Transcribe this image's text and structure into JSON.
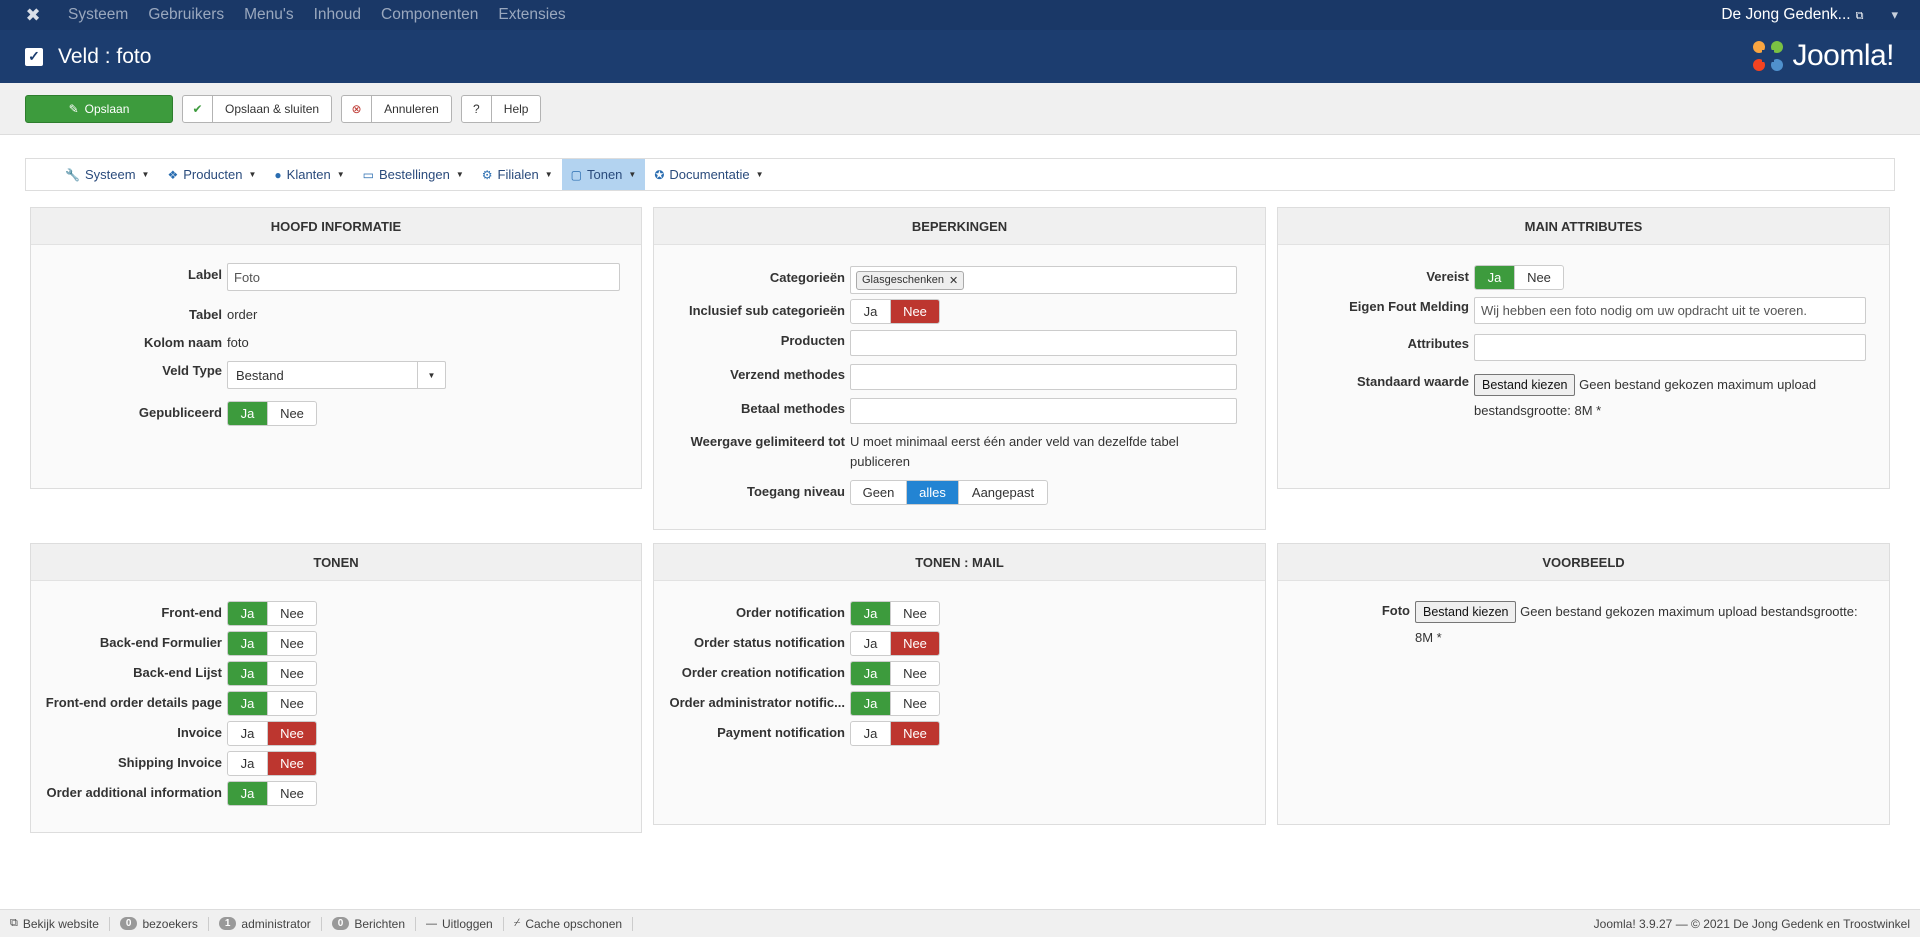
{
  "topnav": {
    "menu": [
      "Systeem",
      "Gebruikers",
      "Menu's",
      "Inhoud",
      "Componenten",
      "Extensies"
    ],
    "site_name": "De Jong Gedenk...",
    "user_icon": "user-icon"
  },
  "titlebar": {
    "title": "Veld : foto",
    "brand": "Joomla!"
  },
  "toolbar": {
    "save": "Opslaan",
    "save_close": "Opslaan & sluiten",
    "cancel": "Annuleren",
    "help": "Help"
  },
  "component_menu": [
    {
      "label": "Systeem",
      "icon": "wrench-icon"
    },
    {
      "label": "Producten",
      "icon": "cubes-icon"
    },
    {
      "label": "Klanten",
      "icon": "user-icon"
    },
    {
      "label": "Bestellingen",
      "icon": "credit-card-icon"
    },
    {
      "label": "Filialen",
      "icon": "cogs-icon"
    },
    {
      "label": "Tonen",
      "icon": "monitor-icon"
    },
    {
      "label": "Documentatie",
      "icon": "life-ring-icon"
    }
  ],
  "hoofd": {
    "title": "HOOFD INFORMATIE",
    "label_lbl": "Label",
    "label_val": "Foto",
    "tabel_lbl": "Tabel",
    "tabel_val": "order",
    "kolom_lbl": "Kolom naam",
    "kolom_val": "foto",
    "type_lbl": "Veld Type",
    "type_val": "Bestand",
    "pub_lbl": "Gepubliceerd"
  },
  "toggle": {
    "ja": "Ja",
    "nee": "Nee"
  },
  "beperkingen": {
    "title": "BEPERKINGEN",
    "cat_lbl": "Categorieën",
    "cat_tag": "Glasgeschenken",
    "sub_lbl": "Inclusief sub categorieën",
    "prod_lbl": "Producten",
    "verzend_lbl": "Verzend methodes",
    "betaal_lbl": "Betaal methodes",
    "weergave_lbl": "Weergave gelimiteerd tot",
    "weergave_val": "U moet minimaal eerst één ander veld van dezelfde tabel publiceren",
    "toegang_lbl": "Toegang niveau",
    "toegang_opts": [
      "Geen",
      "alles",
      "Aangepast"
    ]
  },
  "main_attr": {
    "title": "MAIN ATTRIBUTES",
    "vereist_lbl": "Vereist",
    "fout_lbl": "Eigen Fout Melding",
    "fout_val": "Wij hebben een foto nodig om uw opdracht uit te voeren.",
    "attr_lbl": "Attributes",
    "std_lbl": "Standaard waarde",
    "file_btn": "Bestand kiezen",
    "file_text_1": "Geen bestand gekozen maximum upload",
    "file_text_2": "bestandsgrootte: 8M *"
  },
  "tonen": {
    "title": "TONEN",
    "rows": [
      {
        "label": "Front-end",
        "state": "ja"
      },
      {
        "label": "Back-end Formulier",
        "state": "ja"
      },
      {
        "label": "Back-end Lijst",
        "state": "ja"
      },
      {
        "label": "Front-end order details page",
        "state": "ja"
      },
      {
        "label": "Invoice",
        "state": "nee"
      },
      {
        "label": "Shipping Invoice",
        "state": "nee"
      },
      {
        "label": "Order additional information",
        "state": "ja"
      }
    ]
  },
  "tonen_mail": {
    "title": "TONEN : MAIL",
    "rows": [
      {
        "label": "Order notification",
        "state": "ja"
      },
      {
        "label": "Order status notification",
        "state": "nee"
      },
      {
        "label": "Order creation notification",
        "state": "ja"
      },
      {
        "label": "Order administrator notific...",
        "state": "ja"
      },
      {
        "label": "Payment notification",
        "state": "nee"
      }
    ]
  },
  "voorbeeld": {
    "title": "VOORBEELD",
    "foto_lbl": "Foto",
    "file_btn": "Bestand kiezen",
    "file_text_1": "Geen bestand gekozen maximum upload bestandsgrootte:",
    "file_text_2": "8M *"
  },
  "statusbar": {
    "bekijk": "Bekijk website",
    "bezoekers_count": "0",
    "bezoekers": "bezoekers",
    "admin_count": "1",
    "admin": "administrator",
    "berichten_count": "0",
    "berichten": "Berichten",
    "uitloggen": "Uitloggen",
    "cache": "Cache opschonen",
    "copyright": "Joomla! 3.9.27  —  © 2021 De Jong Gedenk en Troostwinkel"
  },
  "colors": {
    "nav": "#1a3867",
    "title": "#1c3d6f",
    "green": "#3d9b3d",
    "red": "#bd362f",
    "blue": "#2384d3"
  }
}
